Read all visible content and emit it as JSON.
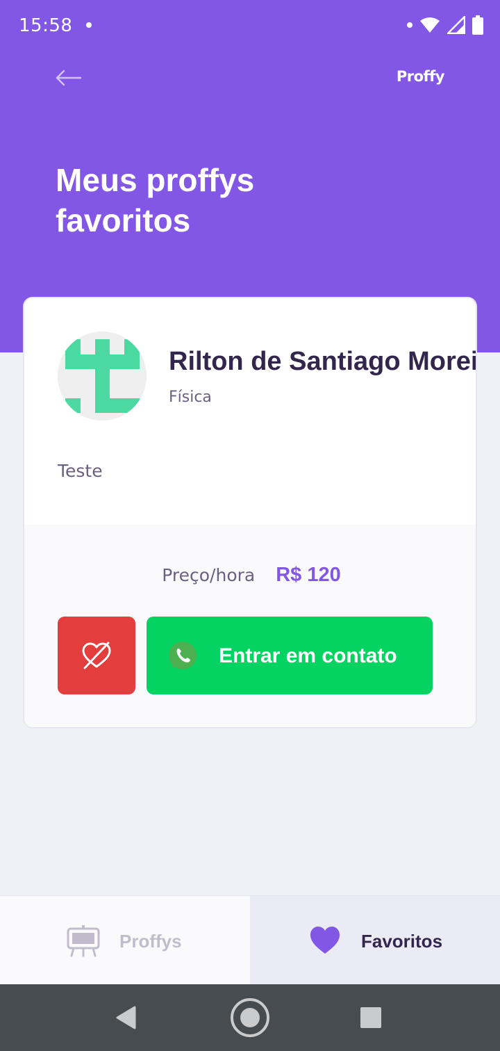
{
  "status_bar": {
    "time": "15:58"
  },
  "header": {
    "brand": "Proffy",
    "title": "Meus proffys favoritos"
  },
  "teacher_card": {
    "name": "Rilton de Santiago Moreira",
    "subject": "Física",
    "bio": "Teste",
    "price_label": "Preço/hora",
    "price_value": "R$ 120",
    "contact_label": "Entrar em contato",
    "is_favorite": true
  },
  "tab_bar": {
    "active": "favoritos",
    "tabs": [
      {
        "label": "Proffys",
        "icon": "easel-icon"
      },
      {
        "label": "Favoritos",
        "icon": "heart-icon"
      }
    ]
  },
  "colors": {
    "primary": "#8257E5",
    "green": "#04D361",
    "red": "#E33D3D",
    "title_dark": "#32264D",
    "text_muted": "#6A6180"
  }
}
